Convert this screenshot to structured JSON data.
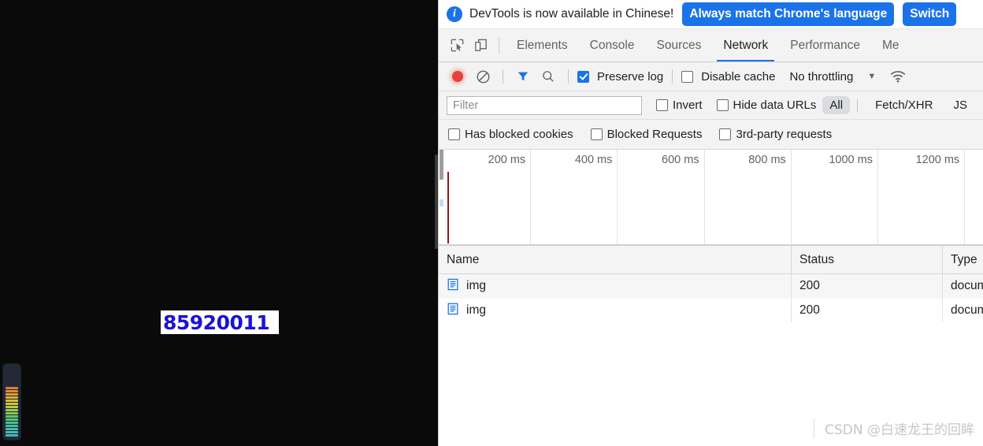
{
  "page_viewport": {
    "background_color": "#0a0a0a",
    "captcha": {
      "name": "captcha-image",
      "text": "85920011",
      "text_color": "#1a12d8",
      "background_color": "#ffffff"
    },
    "level_meter": {
      "name": "audio-level-meter",
      "segment_colors": [
        "#e07a3a",
        "#e18b38",
        "#e09c36",
        "#ddad36",
        "#d7bd38",
        "#cbc93c",
        "#b6cc42",
        "#9ccb4a",
        "#80c857",
        "#68c566",
        "#55c377",
        "#49c08a",
        "#45bd9d",
        "#44bbaa",
        "#46b9b3",
        "#4ab7b8"
      ]
    }
  },
  "devtools": {
    "notification": {
      "icon": "info-icon",
      "message": "DevTools is now available in Chinese!",
      "primary_button": "Always match Chrome's language",
      "secondary_button": "Switch",
      "accent_color": "#1a73e8"
    },
    "toolbar_icons": [
      {
        "name": "inspect-element-icon",
        "title": "Inspect element"
      },
      {
        "name": "device-toolbar-icon",
        "title": "Toggle device toolbar"
      }
    ],
    "tabs": [
      {
        "label": "Elements",
        "active": false
      },
      {
        "label": "Console",
        "active": false
      },
      {
        "label": "Sources",
        "active": false
      },
      {
        "label": "Network",
        "active": true
      },
      {
        "label": "Performance",
        "active": false
      },
      {
        "label": "Me",
        "active": false
      }
    ],
    "network_controls": {
      "record_button": {
        "name": "record-button",
        "color": "#e8413c"
      },
      "clear_button": {
        "name": "clear-button"
      },
      "filter_toggle": {
        "name": "filter-icon",
        "color": "#1a73e8",
        "active": true
      },
      "search_button": {
        "name": "search-icon"
      },
      "preserve_log": {
        "label": "Preserve log",
        "checked": true
      },
      "disable_cache": {
        "label": "Disable cache",
        "checked": false
      },
      "throttling": {
        "value": "No throttling"
      },
      "network_conditions_icon": "wifi-icon"
    },
    "filter_bar": {
      "input_placeholder": "Filter",
      "input_value": "",
      "invert": {
        "label": "Invert",
        "checked": false
      },
      "hide_data_urls": {
        "label": "Hide data URLs",
        "checked": false
      },
      "type_chips": [
        {
          "label": "All",
          "selected": true
        },
        {
          "label": "Fetch/XHR",
          "selected": false
        },
        {
          "label": "JS",
          "selected": false
        }
      ]
    },
    "advanced_filters": [
      {
        "label": "Has blocked cookies",
        "checked": false
      },
      {
        "label": "Blocked Requests",
        "checked": false
      },
      {
        "label": "3rd-party requests",
        "checked": false
      }
    ],
    "overview": {
      "tick_labels": [
        "200 ms",
        "400 ms",
        "600 ms",
        "800 ms",
        "1000 ms",
        "1200 ms"
      ],
      "marker_color": "#a01313"
    },
    "requests": {
      "columns": [
        "Name",
        "Status",
        "Type"
      ],
      "rows": [
        {
          "icon": "document-icon",
          "name": "img",
          "status": "200",
          "type": "docum"
        },
        {
          "icon": "document-icon",
          "name": "img",
          "status": "200",
          "type": "docum"
        }
      ]
    },
    "watermark": "CSDN @白速龙王的回眸"
  }
}
